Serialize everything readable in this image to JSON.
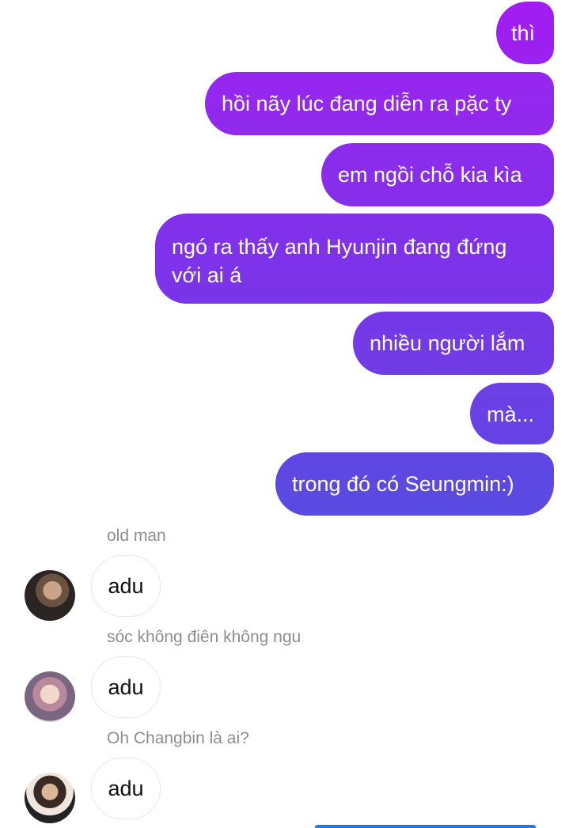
{
  "outgoing": [
    {
      "text": "thì"
    },
    {
      "text": "hồi nãy lúc đang diễn ra pặc ty"
    },
    {
      "text": "em ngồi chỗ kia kìa"
    },
    {
      "lines": [
        "ngó ra thấy anh Hyunjin đang đứng",
        "với ai á"
      ]
    },
    {
      "text": "nhiều người lắm"
    },
    {
      "text": "mà..."
    },
    {
      "text": "trong đó có Seungmin:)"
    }
  ],
  "incoming": [
    {
      "sender": "old man",
      "text": "adu"
    },
    {
      "sender": "sóc không điên không ngu",
      "text": "adu"
    },
    {
      "sender": "Oh Changbin là ai?",
      "text": "adu"
    }
  ],
  "colors": {
    "outgoing_top": "#a31cf3",
    "outgoing_bottom": "#5a4be2",
    "sender_text": "#8e8e8e",
    "incoming_border": "#e6e6e6",
    "accent": "#1b7bea"
  }
}
